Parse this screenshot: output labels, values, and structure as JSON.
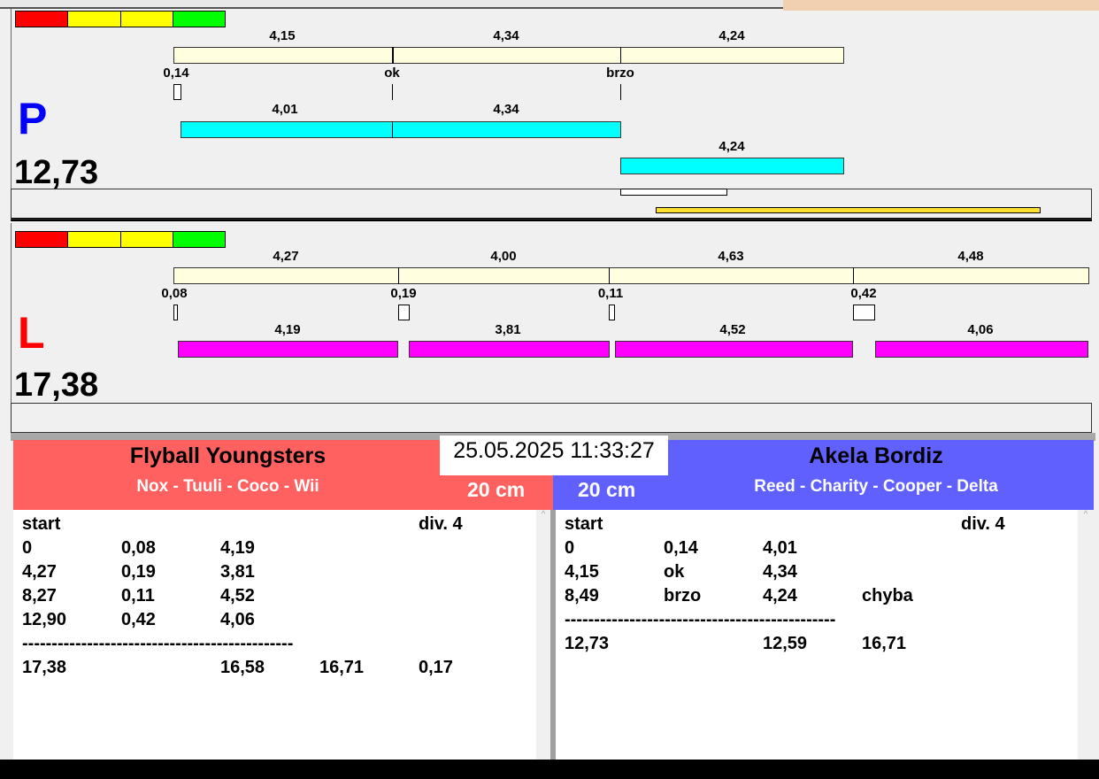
{
  "top": {
    "letter": "P",
    "total": "12,73",
    "lane_labels": [
      "4,15",
      "4,34",
      "4,24"
    ],
    "markers": [
      "0,14",
      "ok",
      "brzo"
    ],
    "run_labels": [
      "4,01",
      "4,34",
      "4,24"
    ]
  },
  "bottom": {
    "letter": "L",
    "total": "17,38",
    "lane_labels": [
      "4,27",
      "4,00",
      "4,63",
      "4,48"
    ],
    "markers": [
      "0,08",
      "0,19",
      "0,11",
      "0,42"
    ],
    "run_labels": [
      "4,19",
      "3,81",
      "4,52",
      "4,06"
    ]
  },
  "datetime": "25.05.2025 11:33:27",
  "left_team": {
    "name": "Flyball Youngsters",
    "dogs": "Nox - Tuuli - Coco - Wii",
    "height": "20 cm",
    "color": "#ff6060",
    "rows": [
      [
        "start",
        "",
        "",
        "",
        "div.  4"
      ],
      [
        "0",
        "0,08",
        "4,19",
        "",
        ""
      ],
      [
        "4,27",
        "0,19",
        "3,81",
        "",
        ""
      ],
      [
        "8,27",
        "0,11",
        "4,52",
        "",
        ""
      ],
      [
        "12,90",
        "0,42",
        "4,06",
        "",
        ""
      ],
      [
        "----------------------------------------------",
        "",
        "",
        "",
        ""
      ],
      [
        "17,38",
        "",
        "16,58",
        "16,71",
        "0,17"
      ]
    ]
  },
  "right_team": {
    "name": "Akela Bordiz",
    "dogs": "Reed - Charity - Cooper - Delta",
    "height": "20 cm",
    "color": "#6060ff",
    "rows": [
      [
        "start",
        "",
        "",
        "",
        "div.  4"
      ],
      [
        "0",
        "0,14",
        "4,01",
        "",
        ""
      ],
      [
        "4,15",
        "ok",
        "4,34",
        "",
        ""
      ],
      [
        "8,49",
        "brzo",
        "4,24",
        "chyba",
        ""
      ],
      [
        "----------------------------------------------",
        "",
        "",
        "",
        ""
      ],
      [
        "12,73",
        "",
        "12,59",
        "16,71",
        ""
      ]
    ]
  }
}
